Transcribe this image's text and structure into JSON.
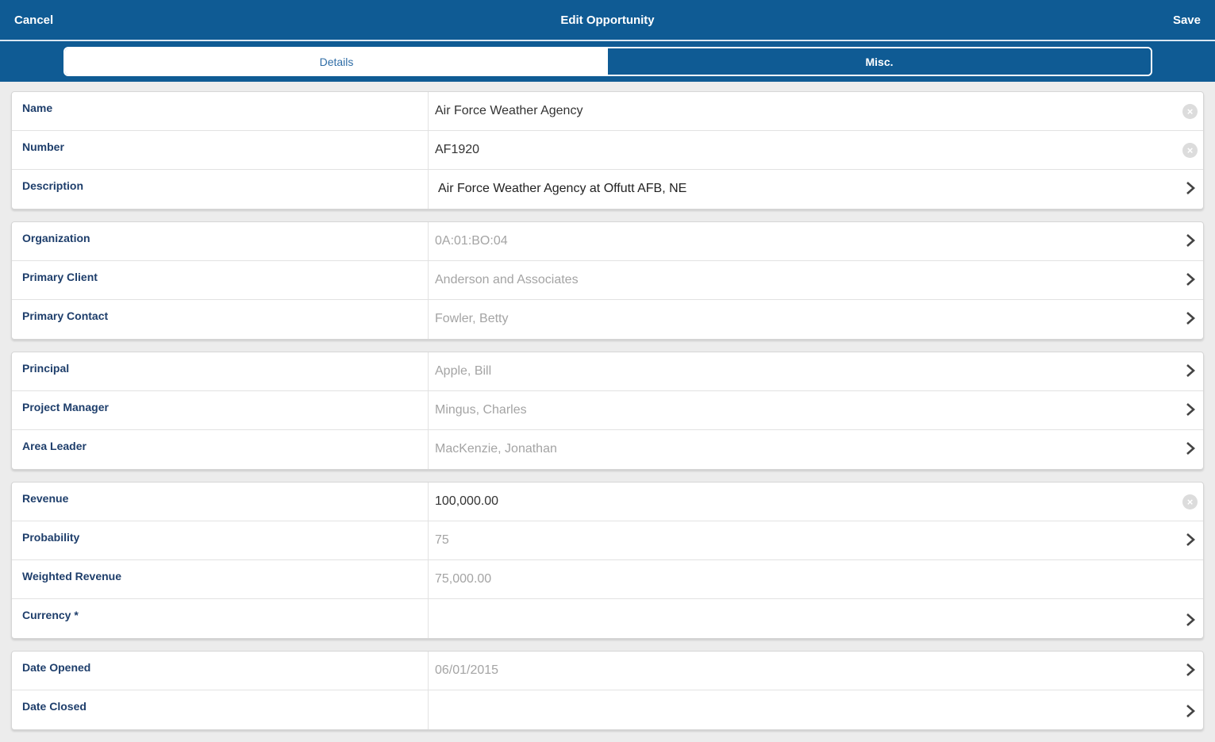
{
  "header": {
    "cancel_label": "Cancel",
    "title": "Edit Opportunity",
    "save_label": "Save"
  },
  "tabs": [
    {
      "label": "Details",
      "active": true
    },
    {
      "label": "Misc.",
      "active": false
    }
  ],
  "groups": [
    {
      "rows": [
        {
          "label": "Name",
          "value": "Air Force Weather Agency",
          "control": "clear"
        },
        {
          "label": "Number",
          "value": "AF1920",
          "control": "clear"
        },
        {
          "label": "Description",
          "value": "Air Force Weather Agency at Offutt AFB, NE",
          "control": "chevron"
        }
      ]
    },
    {
      "rows": [
        {
          "label": "Organization",
          "value": "0A:01:BO:04",
          "control": "chevron"
        },
        {
          "label": "Primary Client",
          "value": "Anderson and Associates",
          "control": "chevron"
        },
        {
          "label": "Primary Contact",
          "value": "Fowler, Betty",
          "control": "chevron"
        }
      ]
    },
    {
      "rows": [
        {
          "label": "Principal",
          "value": "Apple, Bill",
          "control": "chevron"
        },
        {
          "label": "Project Manager",
          "value": "Mingus, Charles",
          "control": "chevron"
        },
        {
          "label": "Area Leader",
          "value": "MacKenzie, Jonathan",
          "control": "chevron"
        }
      ]
    },
    {
      "rows": [
        {
          "label": "Revenue",
          "value": "100,000.00",
          "control": "clear"
        },
        {
          "label": "Probability",
          "value": "75",
          "control": "chevron"
        },
        {
          "label": "Weighted Revenue",
          "value": "75,000.00",
          "control": "none"
        },
        {
          "label": "Currency *",
          "value": "",
          "control": "chevron"
        }
      ]
    },
    {
      "rows": [
        {
          "label": "Date Opened",
          "value": "06/01/2015",
          "control": "chevron"
        },
        {
          "label": "Date Closed",
          "value": "",
          "control": "chevron"
        }
      ]
    }
  ],
  "icons": {
    "clear": "clear-icon",
    "chevron": "chevron-right-icon"
  },
  "colors": {
    "header_bg": "#0f5b94",
    "label": "#1e3e6b",
    "value_dim": "#a4a4a4"
  }
}
